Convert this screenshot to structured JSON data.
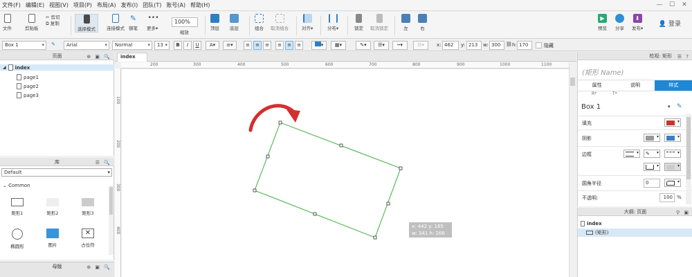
{
  "menu": [
    "文件(F)",
    "编辑(E)",
    "视图(V)",
    "项目(P)",
    "布局(A)",
    "发布(I)",
    "团队(T)",
    "账号(A)",
    "帮助(H)"
  ],
  "toolbar": {
    "new": "文件",
    "paste": "剪贴板",
    "cut": "剪切",
    "copy": "复制",
    "select_mode": "选择模式",
    "connect": "连接模式",
    "pen": "钢笔",
    "more": "更多▾",
    "zoom": "100%",
    "zoom_label": "缩放",
    "top": "顶层",
    "bottom": "底层",
    "group": "组合",
    "ungroup": "取消组合",
    "align": "对齐▾",
    "distribute": "分布▾",
    "lock": "锁定",
    "unlock": "取消锁定",
    "left": "左",
    "right": "右",
    "preview": "预览",
    "share": "分享",
    "publish": "发布▾",
    "login": "登录"
  },
  "format": {
    "style": "Box 1",
    "font": "Arial",
    "weight": "Normal",
    "size": "13",
    "x_label": "x:",
    "x": "462",
    "y_label": "y:",
    "y": "213",
    "w_label": "w:",
    "w": "300",
    "h_label": "h:",
    "h": "170",
    "hidden": "隐藏"
  },
  "pages_panel": {
    "title": "页面",
    "items": [
      "index",
      "page1",
      "page2",
      "page3"
    ]
  },
  "library": {
    "title": "库",
    "selected": "Default",
    "group": "Common",
    "widgets": [
      "矩形1",
      "矩形2",
      "矩形3",
      "椭圆形",
      "图片",
      "占位符"
    ]
  },
  "master_panel": {
    "title": "母版"
  },
  "canvas": {
    "tab": "index",
    "ruler_h": [
      "200",
      "300",
      "400",
      "500",
      "600",
      "700",
      "800",
      "900",
      "1000",
      "1100"
    ],
    "ruler_v": [
      "100",
      "200",
      "300",
      "400"
    ],
    "tooltip_line1": "x: 442   y: 165",
    "tooltip_line2": "w: 341   h: 266"
  },
  "inspector": {
    "title": "检视: 矩形",
    "name_placeholder": "(矩形 Name)",
    "tabs": [
      "属性",
      "说明",
      "样式"
    ],
    "sub_labels": "R*            T*",
    "style_name": "Box 1",
    "fill": "填充",
    "shadow": "阴影",
    "border": "边框",
    "radius": "圆角半径",
    "radius_value": "0",
    "opacity": "不透明:",
    "opacity_value": "100",
    "opacity_unit": "%",
    "fill_color": "#c0392b",
    "shadow_color": "#3a7fc1"
  },
  "outline": {
    "title": "大纲: 页面",
    "root": "index",
    "child": "(矩形)"
  }
}
